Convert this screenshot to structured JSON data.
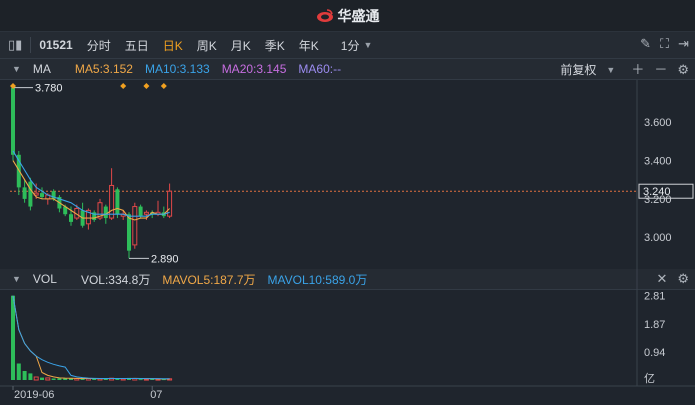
{
  "brand": {
    "name": "华盛通"
  },
  "toolbar": {
    "symbol": "01521",
    "periods": [
      "分时",
      "五日",
      "日K",
      "周K",
      "月K",
      "季K",
      "年K"
    ],
    "active_period": "日K",
    "interval": "1分"
  },
  "ma_panel": {
    "label": "MA",
    "ma5": "MA5:3.152",
    "ma10": "MA10:3.133",
    "ma20": "MA20:3.145",
    "ma60": "MA60:--",
    "adjust": "前复权",
    "high_label": "3.780",
    "low_label": "2.890",
    "current_price": "3.240",
    "y_ticks": [
      "3.600",
      "3.400",
      "3.200",
      "3.000"
    ]
  },
  "vol_panel": {
    "label": "VOL",
    "vol": "VOL:334.8万",
    "mavol5": "MAVOL5:187.7万",
    "mavol10": "MAVOL10:589.0万",
    "y_ticks": [
      "2.81",
      "1.87",
      "0.94"
    ],
    "unit": "亿"
  },
  "x_axis": [
    "2019-06",
    "07"
  ],
  "colors": {
    "up": "#e04848",
    "down": "#2ebd5a",
    "ma5": "#f0a848",
    "ma10": "#3aa3e8",
    "ma20": "#c76ee0",
    "ma60": "#9c8cf0",
    "accent": "#f0a020"
  },
  "chart_data": {
    "type": "candlestick",
    "candles": [
      {
        "open": 3.78,
        "high": 3.78,
        "low": 3.4,
        "close": 3.43
      },
      {
        "open": 3.43,
        "high": 3.45,
        "low": 3.22,
        "close": 3.26
      },
      {
        "open": 3.26,
        "high": 3.3,
        "low": 3.18,
        "close": 3.2
      },
      {
        "open": 3.29,
        "high": 3.31,
        "low": 3.14,
        "close": 3.16
      },
      {
        "open": 3.22,
        "high": 3.28,
        "low": 3.2,
        "close": 3.23
      },
      {
        "open": 3.23,
        "high": 3.26,
        "low": 3.2,
        "close": 3.21
      },
      {
        "open": 3.2,
        "high": 3.23,
        "low": 3.17,
        "close": 3.22
      },
      {
        "open": 3.24,
        "high": 3.25,
        "low": 3.19,
        "close": 3.2
      },
      {
        "open": 3.21,
        "high": 3.22,
        "low": 3.13,
        "close": 3.15
      },
      {
        "open": 3.16,
        "high": 3.17,
        "low": 3.11,
        "close": 3.12
      },
      {
        "open": 3.12,
        "high": 3.16,
        "low": 3.06,
        "close": 3.08
      },
      {
        "open": 3.1,
        "high": 3.17,
        "low": 3.09,
        "close": 3.15
      },
      {
        "open": 3.14,
        "high": 3.18,
        "low": 3.05,
        "close": 3.06
      },
      {
        "open": 3.07,
        "high": 3.15,
        "low": 3.04,
        "close": 3.14
      },
      {
        "open": 3.13,
        "high": 3.14,
        "low": 3.08,
        "close": 3.09
      },
      {
        "open": 3.1,
        "high": 3.2,
        "low": 3.09,
        "close": 3.18
      },
      {
        "open": 3.16,
        "high": 3.17,
        "low": 3.07,
        "close": 3.1
      },
      {
        "open": 3.1,
        "high": 3.36,
        "low": 3.09,
        "close": 3.27
      },
      {
        "open": 3.25,
        "high": 3.26,
        "low": 3.1,
        "close": 3.12
      },
      {
        "open": 3.11,
        "high": 3.14,
        "low": 3.09,
        "close": 3.12
      },
      {
        "open": 3.12,
        "high": 3.13,
        "low": 2.89,
        "close": 2.93
      },
      {
        "open": 2.96,
        "high": 3.18,
        "low": 2.94,
        "close": 3.16
      },
      {
        "open": 3.16,
        "high": 3.17,
        "low": 3.1,
        "close": 3.11
      },
      {
        "open": 3.12,
        "high": 3.14,
        "low": 3.09,
        "close": 3.13
      },
      {
        "open": 3.13,
        "high": 3.14,
        "low": 3.1,
        "close": 3.12
      },
      {
        "open": 3.12,
        "high": 3.19,
        "low": 3.11,
        "close": 3.13
      },
      {
        "open": 3.13,
        "high": 3.16,
        "low": 3.1,
        "close": 3.11
      },
      {
        "open": 3.11,
        "high": 3.28,
        "low": 3.1,
        "close": 3.24
      }
    ],
    "ma5_line": [
      3.4,
      3.35,
      3.3,
      3.25,
      3.21,
      3.2,
      3.2,
      3.2,
      3.18,
      3.16,
      3.14,
      3.12,
      3.1,
      3.1,
      3.1,
      3.11,
      3.12,
      3.14,
      3.15,
      3.14,
      3.1,
      3.09,
      3.1,
      3.1,
      3.13,
      3.12,
      3.12,
      3.15
    ],
    "ma10_line": [
      3.45,
      3.4,
      3.35,
      3.3,
      3.26,
      3.24,
      3.22,
      3.21,
      3.2,
      3.19,
      3.18,
      3.16,
      3.14,
      3.13,
      3.12,
      3.12,
      3.12,
      3.12,
      3.12,
      3.12,
      3.11,
      3.11,
      3.11,
      3.11,
      3.12,
      3.12,
      3.12,
      3.13
    ],
    "volume": [
      2.81,
      0.55,
      0.3,
      0.22,
      0.1,
      0.08,
      0.07,
      0.05,
      0.06,
      0.05,
      0.06,
      0.05,
      0.04,
      0.05,
      0.04,
      0.05,
      0.04,
      0.06,
      0.05,
      0.04,
      0.07,
      0.05,
      0.03,
      0.03,
      0.04,
      0.03,
      0.03,
      0.04
    ],
    "y_range": [
      2.85,
      3.82
    ],
    "vol_range": [
      0,
      3.0
    ]
  }
}
